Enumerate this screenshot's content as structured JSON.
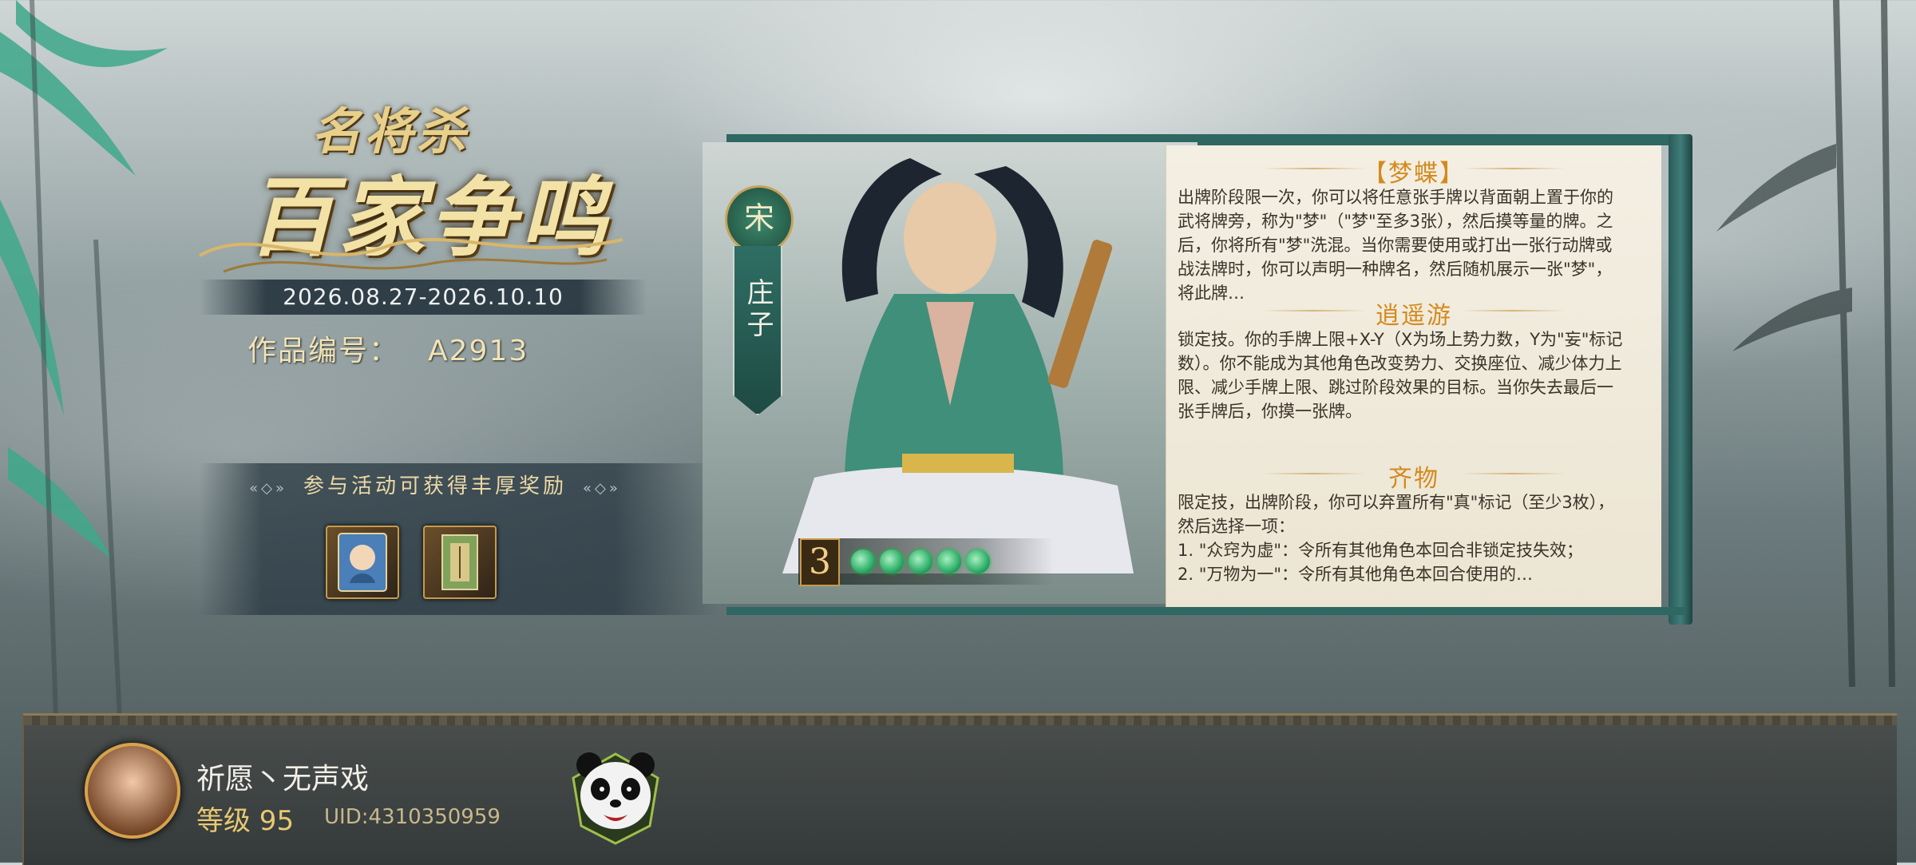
{
  "event": {
    "logo_top": "名将杀",
    "logo_main": "百家争鸣",
    "date_range": "2026.08.27-2026.10.10",
    "work_id_label": "作品编号：",
    "work_id": "A2913",
    "reward_title": "参与活动可获得丰厚奖励",
    "rewards": [
      "character-card",
      "scroll-item"
    ]
  },
  "character": {
    "faction": "宋",
    "name": "庄子",
    "hp": "3",
    "jade_count": 5,
    "skills": [
      {
        "title": "【梦蝶】",
        "body": "出牌阶段限一次，你可以将任意张手牌以背面朝上置于你的武将牌旁，称为\"梦\"（\"梦\"至多3张），然后摸等量的牌。之后，你将所有\"梦\"洗混。当你需要使用或打出一张行动牌或战法牌时，你可以声明一种牌名，然后随机展示一张\"梦\"，将此牌…"
      },
      {
        "title": "逍遥游",
        "body": "锁定技。你的手牌上限+X-Y（X为场上势力数，Y为\"妄\"标记数）。你不能成为其他角色改变势力、交换座位、减少体力上限、减少手牌上限、跳过阶段效果的目标。当你失去最后一张手牌后，你摸一张牌。"
      },
      {
        "title": "齐物",
        "body": "限定技，出牌阶段，你可以弃置所有\"真\"标记（至少3枚），然后选择一项：\n1. \"众窍为虚\"：令所有其他角色本回合非锁定技失效；\n2. \"万物为一\"：令所有其他角色本回合使用的…"
      }
    ]
  },
  "player": {
    "name": "祈愿丶无声戏",
    "level": "等级 95",
    "uid": "UID:4310350959"
  },
  "colors": {
    "accent_gold": "#d48a1e",
    "jade": "#2fae6a",
    "teal_frame": "#2f6762"
  }
}
